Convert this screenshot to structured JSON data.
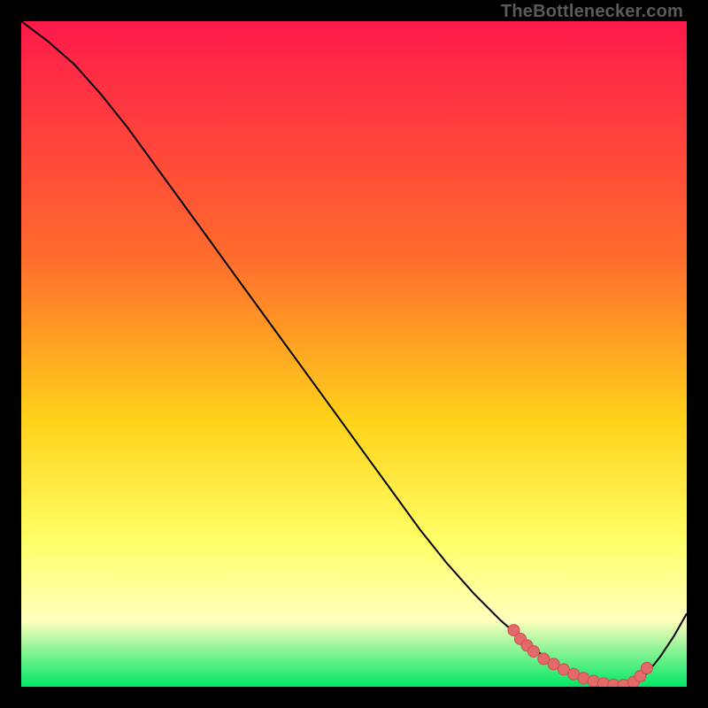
{
  "watermark": "TheBottlenecker.com",
  "colors": {
    "grad_top": "#ff1a4b",
    "grad_mid1": "#ff6a2d",
    "grad_mid2": "#ffd21a",
    "grad_low": "#ffff66",
    "grad_pale": "#ffffbd",
    "grad_bottom": "#00e765",
    "curve": "#000000",
    "marker": "#e46a6a",
    "marker_stroke": "#c94f4f"
  },
  "chart_data": {
    "type": "line",
    "title": "",
    "xlabel": "",
    "ylabel": "",
    "xlim": [
      0,
      100
    ],
    "ylim": [
      0,
      100
    ],
    "series": [
      {
        "name": "bottleneck-curve",
        "x": [
          0,
          4,
          8,
          12,
          16,
          20,
          24,
          28,
          32,
          36,
          40,
          44,
          48,
          52,
          56,
          60,
          64,
          68,
          72,
          76,
          78,
          80,
          82,
          84,
          86,
          88,
          90,
          92,
          94,
          96,
          98,
          100
        ],
        "y": [
          100,
          97,
          93.5,
          89,
          84,
          78.5,
          73,
          67.5,
          62,
          56.5,
          51,
          45.5,
          40,
          34.5,
          29,
          23.5,
          18.5,
          14,
          10,
          6.5,
          5,
          3.6,
          2.4,
          1.4,
          0.7,
          0.3,
          0.15,
          0.6,
          2.0,
          4.5,
          7.5,
          11
        ]
      }
    ],
    "markers": {
      "name": "optimum-cluster",
      "points": [
        {
          "x": 74,
          "y": 8.5
        },
        {
          "x": 75,
          "y": 7.2
        },
        {
          "x": 76,
          "y": 6.2
        },
        {
          "x": 77,
          "y": 5.3
        },
        {
          "x": 78.5,
          "y": 4.2
        },
        {
          "x": 80,
          "y": 3.4
        },
        {
          "x": 81.5,
          "y": 2.6
        },
        {
          "x": 83,
          "y": 1.9
        },
        {
          "x": 84.5,
          "y": 1.3
        },
        {
          "x": 86,
          "y": 0.85
        },
        {
          "x": 87.5,
          "y": 0.5
        },
        {
          "x": 89,
          "y": 0.3
        },
        {
          "x": 90.5,
          "y": 0.25
        },
        {
          "x": 92,
          "y": 0.7
        },
        {
          "x": 93,
          "y": 1.6
        },
        {
          "x": 94,
          "y": 2.8
        }
      ]
    }
  }
}
